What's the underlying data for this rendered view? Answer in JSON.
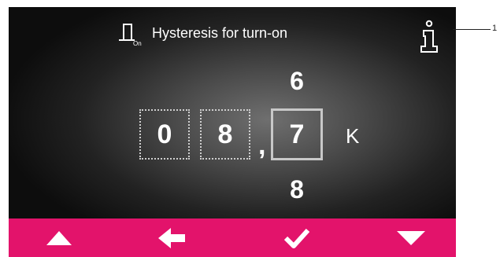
{
  "header": {
    "title": "Hysteresis for turn-on",
    "param_icon": "hysteresis-on-icon",
    "param_icon_subscript": "On",
    "info_icon": "info-icon"
  },
  "value_editor": {
    "digits": [
      "0",
      "8",
      "7"
    ],
    "separator": ",",
    "unit": "K",
    "selected_index": 2,
    "above_selected": "6",
    "below_selected": "8"
  },
  "footer": {
    "background": "#e3136b",
    "buttons": [
      {
        "name": "up-arrow-icon"
      },
      {
        "name": "back-arrow-icon"
      },
      {
        "name": "checkmark-icon"
      },
      {
        "name": "down-arrow-icon"
      }
    ]
  },
  "annotation": {
    "marker": "1"
  }
}
